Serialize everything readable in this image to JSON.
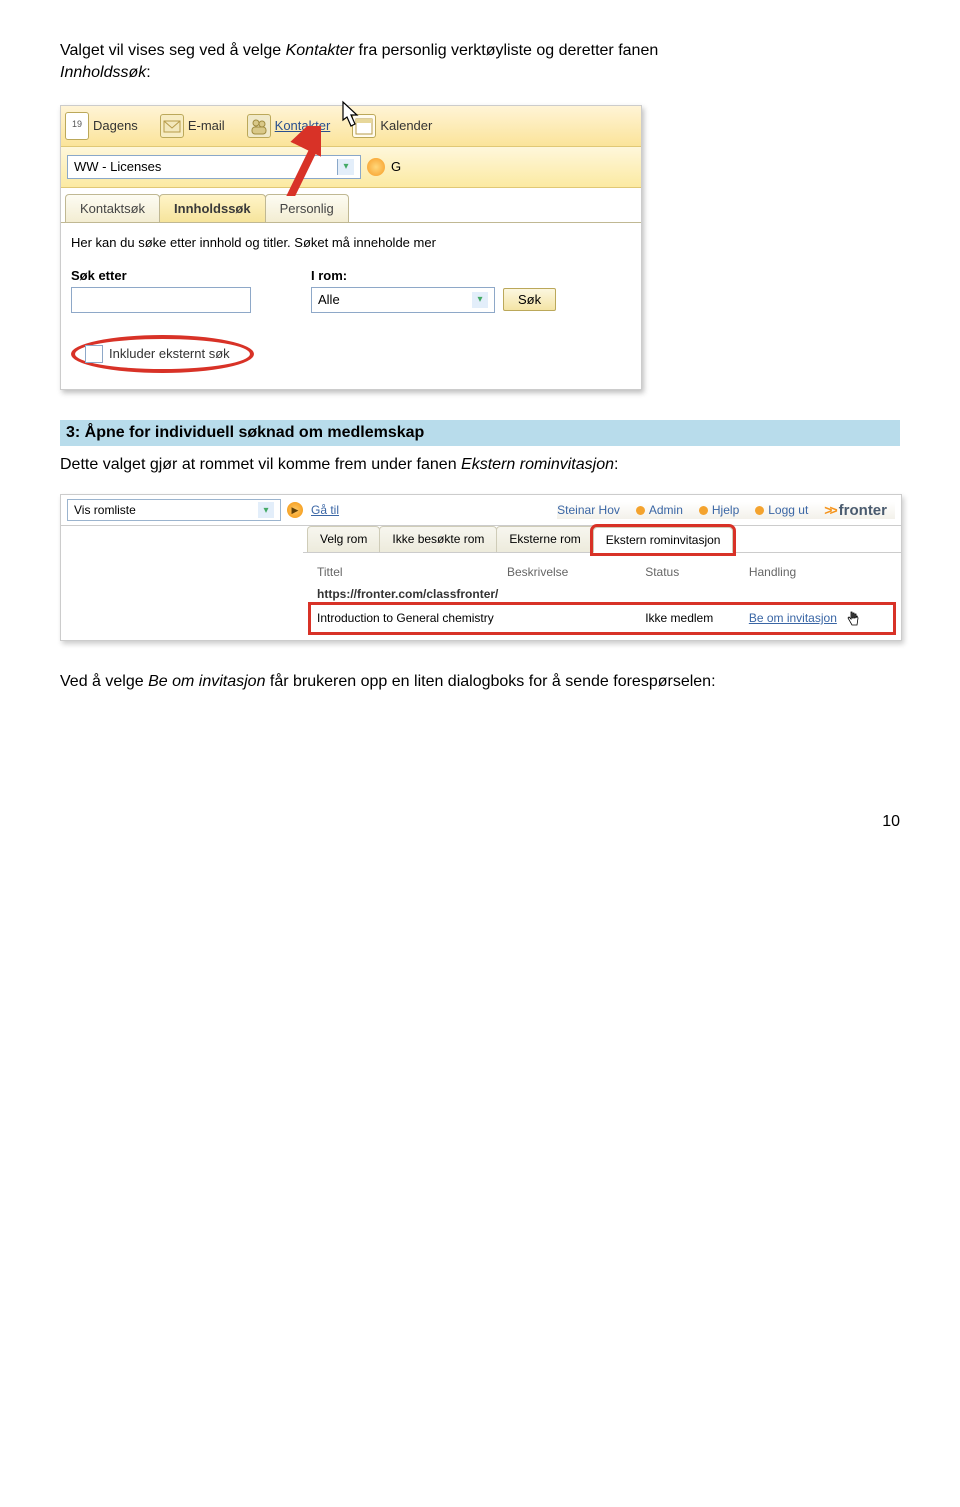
{
  "intro": {
    "line1_a": "Valget vil vises seg ved å velge ",
    "line1_em": "Kontakter",
    "line1_b": " fra personlig verktøyliste og deretter fanen ",
    "line2_em": "Innholdssøk",
    "line2_b": ":"
  },
  "toolbar": {
    "dagens": "Dagens",
    "dagens_badge": "19",
    "email": "E-mail",
    "kontakter": "Kontakter",
    "kalender": "Kalender"
  },
  "roomdd": {
    "value": "WW - Licenses",
    "right_letter": "G"
  },
  "tabs1": {
    "t0": "Kontaktsøk",
    "t1": "Innholdssøk",
    "t2": "Personlig"
  },
  "help": "Her kan du søke etter innhold og titler. Søket må inneholde mer",
  "search": {
    "label_left": "Søk etter",
    "label_right": "I rom:",
    "room_value": "Alle",
    "btn": "Søk",
    "ext": "Inkluder eksternt søk"
  },
  "section_heading": "3: Åpne for individuell søknad om medlemskap",
  "para2_a": "Dette valget gjør at rommet vil komme frem under fanen ",
  "para2_em": "Ekstern rominvitasjon",
  "para2_b": ":",
  "shot2": {
    "roomlist": "Vis romliste",
    "goto": "Gå til",
    "user": "Steinar Hov",
    "admin": "Admin",
    "help": "Hjelp",
    "logout": "Logg ut",
    "brand": "fronter",
    "tabs": {
      "t0": "Velg rom",
      "t1": "Ikke besøkte rom",
      "t2": "Eksterne rom",
      "t3": "Ekstern rominvitasjon"
    },
    "cols": {
      "c0": "Tittel",
      "c1": "Beskrivelse",
      "c2": "Status",
      "c3": "Handling"
    },
    "url": "https://fronter.com/classfronter/",
    "row": {
      "title": "Introduction to General chemistry",
      "descr": "",
      "status": "Ikke medlem",
      "action": "Be om invitasjon"
    }
  },
  "para3_a": "Ved å velge ",
  "para3_em": "Be om invitasjon",
  "para3_b": " får brukeren opp en liten dialogboks for å sende forespørselen:",
  "page_number": "10"
}
